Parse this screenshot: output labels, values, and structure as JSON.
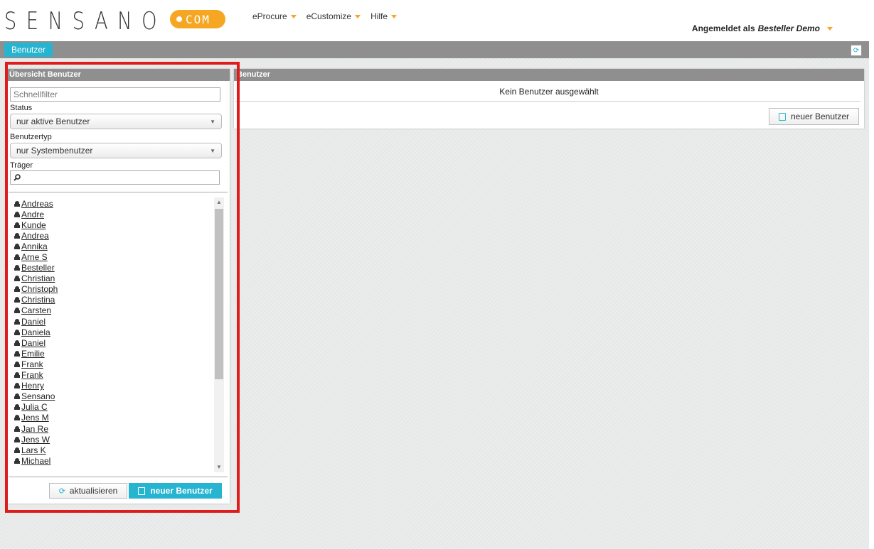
{
  "header": {
    "logo_text": "SENSANO",
    "logo_badge": "COM",
    "nav": [
      {
        "label": "eProcure"
      },
      {
        "label": "eCustomize"
      },
      {
        "label": "Hilfe"
      }
    ],
    "user_prefix": "Angemeldet als",
    "user_name": "Besteller Demo"
  },
  "toolbar": {
    "tab_label": "Benutzer",
    "refresh_icon": "refresh-icon"
  },
  "left_panel": {
    "title": "Übersicht Benutzer",
    "quick_filter_placeholder": "Schnellfilter",
    "status_label": "Status",
    "status_value": "nur aktive Benutzer",
    "type_label": "Benutzertyp",
    "type_value": "nur Systembenutzer",
    "carrier_label": "Träger",
    "users": [
      "Andreas",
      "Andre",
      "Kunde",
      "Andrea",
      "Annika",
      "Arne S",
      "Besteller",
      "Christian",
      "Christoph",
      "Christina",
      "Carsten",
      "Daniel",
      "Daniela",
      "Daniel",
      "Emilie",
      "Frank",
      "Frank",
      "Henry",
      "Sensano",
      "Julia C",
      "Jens M",
      "Jan Re",
      "Jens W",
      "Lars K",
      "Michael"
    ],
    "refresh_label": "aktualisieren",
    "new_user_label": "neuer Benutzer"
  },
  "right_panel": {
    "title": "Benutzer",
    "message": "Kein Benutzer ausgewählt",
    "new_user_label": "neuer Benutzer"
  },
  "colors": {
    "accent": "#27b4d0",
    "logo_badge": "#f5a623",
    "highlight": "#e01b1b"
  }
}
